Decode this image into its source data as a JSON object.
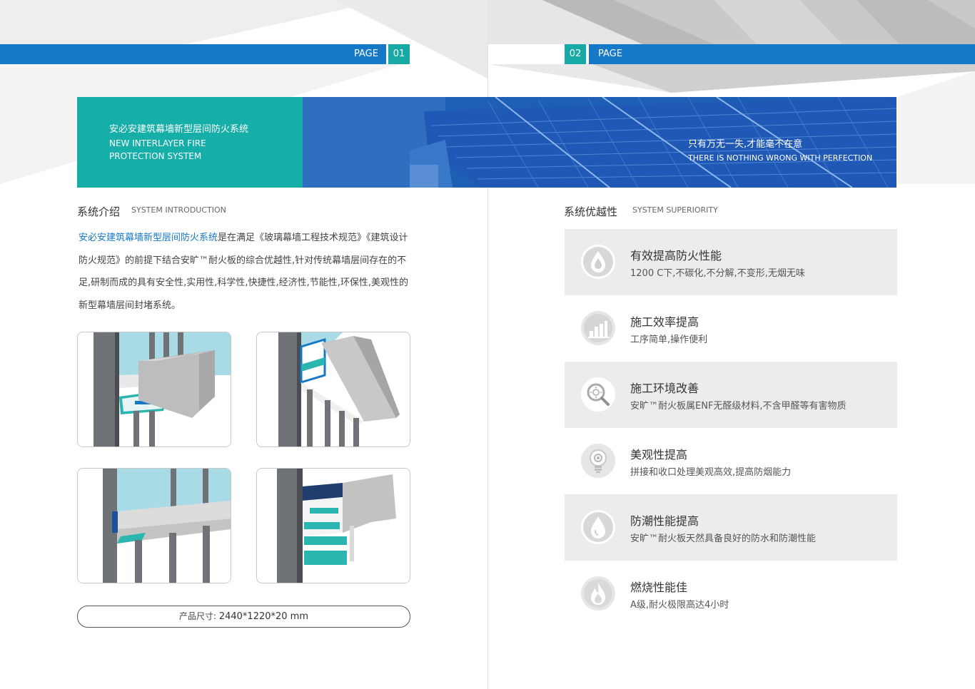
{
  "page_left": {
    "label": "PAGE",
    "number": "01"
  },
  "page_right": {
    "label": "PAGE",
    "number": "02"
  },
  "banner": {
    "title_cn": "安必安建筑幕墙新型层间防火系统",
    "title_en_line1": "NEW INTERLAYER FIRE",
    "title_en_line2": "PROTECTION SYSTEM",
    "slogan_cn": "只有万无一失,才能毫不在意",
    "slogan_en": "THERE IS NOTHING WRONG WITH PERFECTION"
  },
  "intro": {
    "heading_cn": "系统介绍",
    "heading_en": "SYSTEM INTRODUCTION",
    "highlight": "安必安建筑幕墙新型层间防火系统",
    "body": "是在满足《玻璃幕墙工程技术规范》《建筑设计防火规范》的前提下结合安旷™耐火板的综合优越性,针对传统幕墙层间存在的不足,研制而成的具有安全性,实用性,科学性,快捷性,经济性,节能性,环保性,美观性的新型幕墙层间封堵系统。"
  },
  "product_size": {
    "label": "产品尺寸:",
    "value": "2440*1220*20 mm"
  },
  "superiority": {
    "heading_cn": "系统优越性",
    "heading_en": "SYSTEM SUPERIORITY",
    "items": [
      {
        "icon": "fire-drop-icon",
        "title": "有效提高防火性能",
        "desc": "1200 C下,不碳化,不分解,不变形,无烟无味"
      },
      {
        "icon": "bar-chart-icon",
        "title": "施工效率提高",
        "desc": "工序简单,操作便利"
      },
      {
        "icon": "magnifier-gear-icon",
        "title": "施工环境改善",
        "desc": "安旷™耐火板属ENF无醛级材料,不含甲醛等有害物质"
      },
      {
        "icon": "lightbulb-icon",
        "title": "美观性提高",
        "desc": "拼接和收口处理美观高效,提高防烟能力"
      },
      {
        "icon": "water-drop-icon",
        "title": "防潮性能提高",
        "desc": "安旷™耐火板天然具备良好的防水和防潮性能"
      },
      {
        "icon": "flame-icon",
        "title": "燃烧性能佳",
        "desc": "A级,耐火极限高达4小时"
      }
    ]
  },
  "colors": {
    "blue": "#1579c8",
    "teal": "#17a9a5",
    "banner_blue": "#1d5fb4",
    "panel_gray": "#ececec"
  }
}
